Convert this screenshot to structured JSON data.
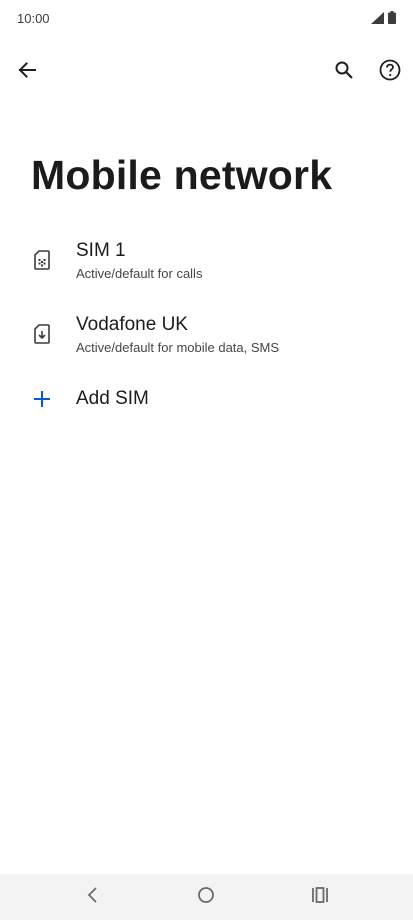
{
  "status_bar": {
    "time": "10:00",
    "icons": [
      "signal-icon",
      "battery-icon"
    ]
  },
  "toolbar": {
    "icons": [
      "back-arrow-icon",
      "search-icon",
      "help-icon"
    ]
  },
  "page": {
    "title": "Mobile network"
  },
  "sims": [
    {
      "name": "SIM 1",
      "status": "Active/default for calls",
      "icon": "sim-card-icon"
    },
    {
      "name": "Vodafone UK",
      "status": "Active/default for mobile data, SMS",
      "icon": "sim-download-icon"
    }
  ],
  "add_sim": {
    "label": "Add SIM",
    "icon": "plus-icon"
  },
  "nav_bar": {
    "icons": [
      "nav-back-icon",
      "nav-home-icon",
      "nav-recents-icon"
    ]
  },
  "colors": {
    "accent": "#0b57d0",
    "text_primary": "#1b1b1b",
    "text_secondary": "#444746",
    "nav_bar_bg": "#f3f3f3"
  }
}
